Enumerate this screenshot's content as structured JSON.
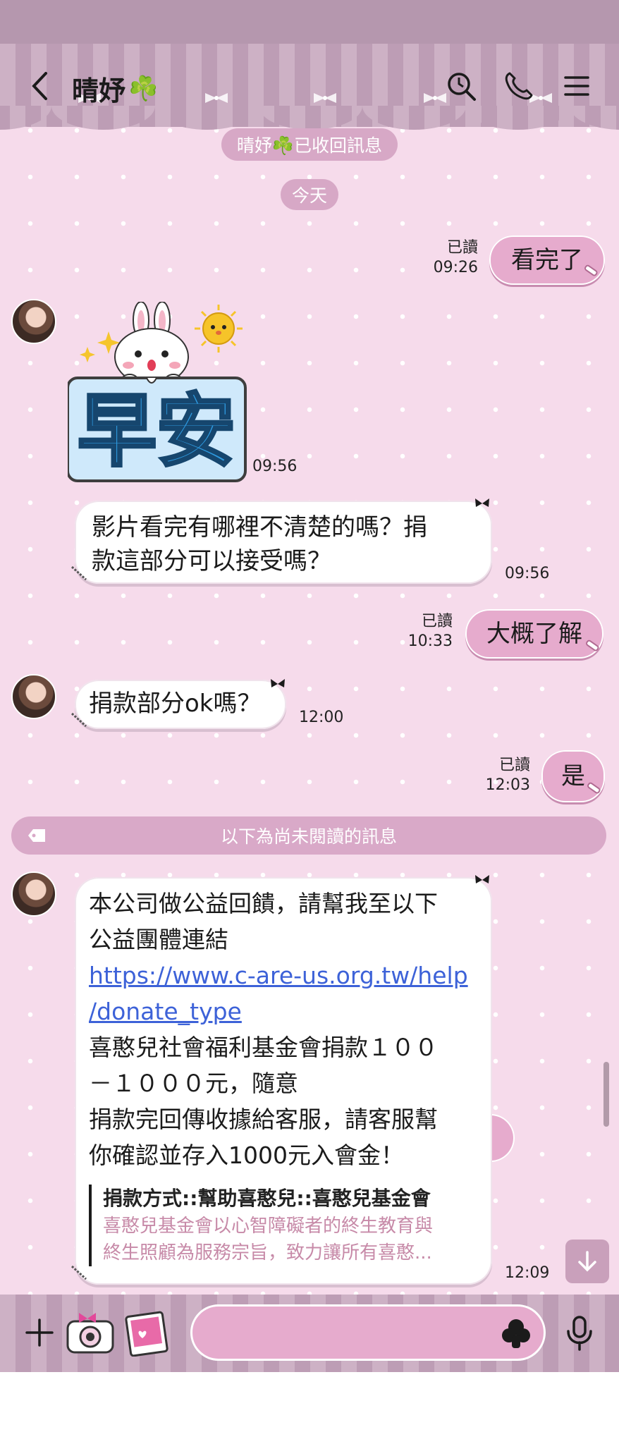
{
  "header": {
    "contact_name": "晴妤",
    "clover": "☘️"
  },
  "notices": {
    "recalled": "晴妤☘️已收回訊息",
    "date": "今天",
    "unread_divider": "以下為尚未閱讀的訊息"
  },
  "messages": {
    "m1": {
      "text": "看完了",
      "read": "已讀",
      "time": "09:26"
    },
    "m2": {
      "sticker_text": "早安",
      "time": "09:56"
    },
    "m3": {
      "line1": "影片看完有哪裡不清楚的嗎？捐",
      "line2": "款這部分可以接受嗎？",
      "time": "09:56"
    },
    "m4": {
      "text": "大概了解",
      "read": "已讀",
      "time": "10:33"
    },
    "m5": {
      "text": "捐款部分ok嗎？",
      "time": "12:00"
    },
    "m6": {
      "text": "是",
      "read": "已讀",
      "time": "12:03"
    },
    "m7": {
      "line1": "本公司做公益回饋，請幫我至以下",
      "line2": "公益團體連結",
      "link1": "https://www.c-are-us.org.tw/help",
      "link2": "/donate_type",
      "line3": "喜憨兒社會福利基金會捐款１００",
      "line4": "－１０００元，隨意",
      "line5": "捐款完回傳收據給客服，請客服幫",
      "line6": "你確認並存入1000元入會金！",
      "preview_title": "捐款方式::幫助喜憨兒::喜憨兒基金會",
      "preview_desc1": "喜憨兒基金會以心智障礙者的終生教育與",
      "preview_desc2": "終生照顧為服務宗旨，致力讓所有喜憨...",
      "time": "12:09"
    }
  },
  "icons": {
    "back": "back-chevron-icon",
    "search": "search-icon",
    "call": "phone-icon",
    "menu": "menu-icon",
    "plus": "plus-icon",
    "camera": "camera-icon",
    "gallery": "photo-icon",
    "emoji": "sticker-icon",
    "mic": "microphone-icon",
    "scroll_down": "arrow-down-icon"
  },
  "colors": {
    "background": "#f6dbeb",
    "header": "#bd9db5",
    "outgoing_bubble": "#e6abcd",
    "incoming_bubble": "#ffffff",
    "link": "#3d62d8"
  }
}
